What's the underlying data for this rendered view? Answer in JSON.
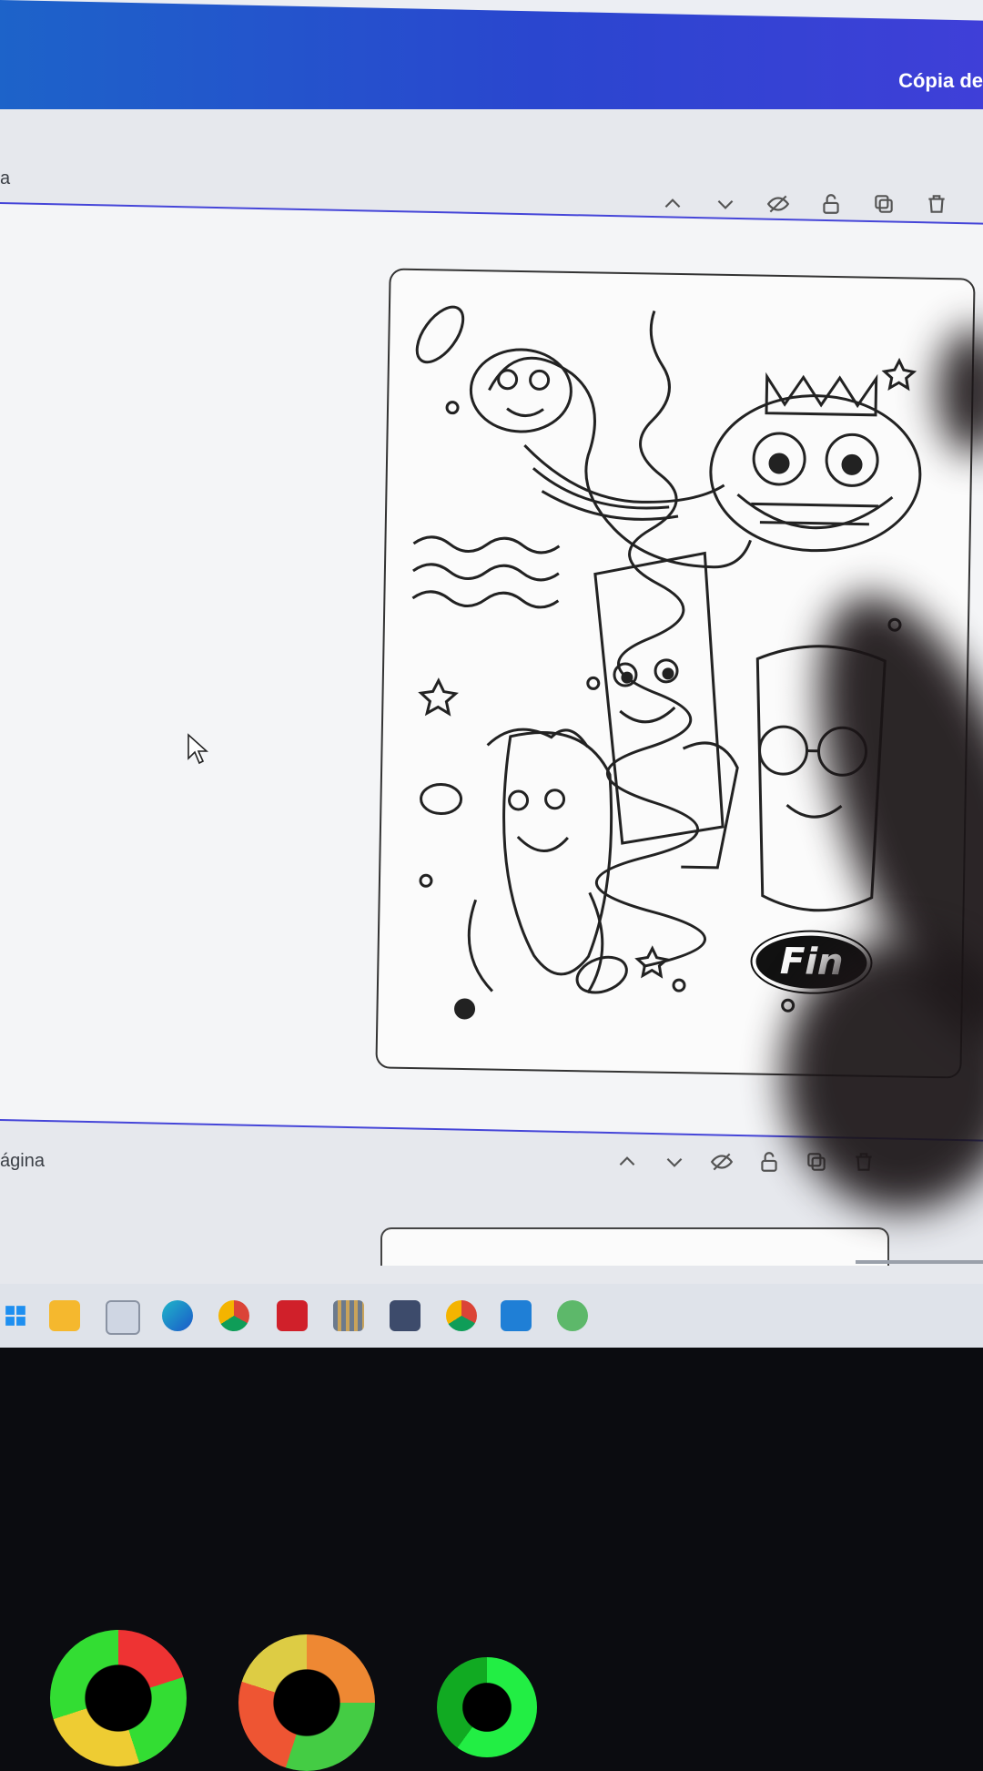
{
  "document": {
    "title": "Cópia de"
  },
  "page_header_top": {
    "label": "a"
  },
  "page_header_bottom": {
    "label": "ágina"
  },
  "card": {
    "logo_text": "Fin"
  },
  "colors": {
    "topbar": "#2a46cf",
    "page_border": "#4545d8",
    "workspace": "#e6e8ed",
    "taskbar": "#dfe3ea"
  },
  "toolbar_icons": [
    "chevron-up-icon",
    "chevron-down-icon",
    "hide-icon",
    "lock-icon",
    "duplicate-icon",
    "trash-icon",
    "add-page-icon"
  ],
  "taskbar_icons": [
    "windows-start-icon",
    "file-explorer-icon",
    "store-icon",
    "edge-icon",
    "chrome-icon",
    "acrobat-icon",
    "library-icon",
    "calculator-icon",
    "chrome-profile-icon",
    "vscode-icon",
    "app-icon"
  ]
}
